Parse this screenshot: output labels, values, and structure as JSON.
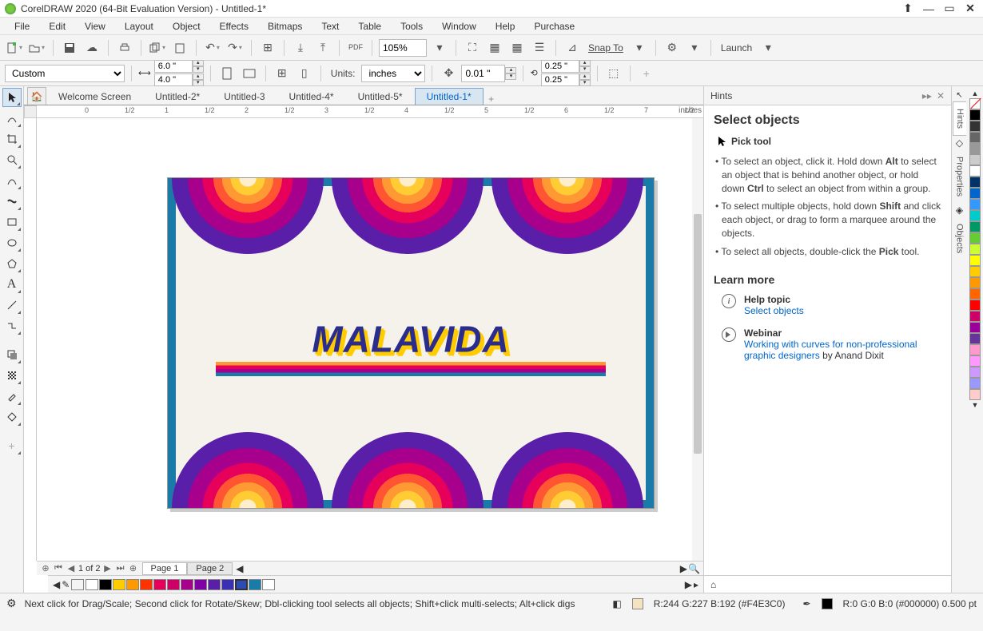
{
  "titlebar": {
    "title": "CorelDRAW 2020 (64-Bit Evaluation Version) - Untitled-1*"
  },
  "menu": [
    "File",
    "Edit",
    "View",
    "Layout",
    "Object",
    "Effects",
    "Bitmaps",
    "Text",
    "Table",
    "Tools",
    "Window",
    "Help",
    "Purchase"
  ],
  "toolbar": {
    "zoom": "105%",
    "snapto": "Snap To",
    "launch": "Launch"
  },
  "propbar": {
    "preset": "Custom",
    "width": "6.0 \"",
    "height": "4.0 \"",
    "units_label": "Units:",
    "units": "inches",
    "nudge": "0.01 \"",
    "dupx": "0.25 \"",
    "dupy": "0.25 \""
  },
  "tabs": {
    "items": [
      "Welcome Screen",
      "Untitled-2*",
      "Untitled-3",
      "Untitled-4*",
      "Untitled-5*",
      "Untitled-1*"
    ],
    "active": 5
  },
  "ruler": {
    "units": "inches"
  },
  "pages": {
    "counter": "1 of 2",
    "tabs": [
      "Page 1",
      "Page 2"
    ],
    "active": 0
  },
  "design": {
    "text": "MALAVIDA"
  },
  "hints": {
    "panel": "Hints",
    "heading": "Select objects",
    "pick_tool": "Pick tool",
    "bullets": [
      {
        "pre": "To select an object, click it. Hold down ",
        "b1": "Alt",
        "mid": " to select an object that is behind another object, or hold down ",
        "b2": "Ctrl",
        "post": " to select an object from within a group."
      },
      {
        "pre": "To select multiple objects, hold down ",
        "b1": "Shift",
        "mid": " and click each object, or drag to form a marquee around the objects.",
        "b2": "",
        "post": ""
      },
      {
        "pre": "To select all objects, double-click the ",
        "b1": "Pick",
        "mid": " tool.",
        "b2": "",
        "post": ""
      }
    ],
    "learn_more": "Learn more",
    "help_topic_label": "Help topic",
    "help_topic_link": "Select objects",
    "webinar_label": "Webinar",
    "webinar_link": "Working with curves for non-professional graphic designers",
    "webinar_by": " by Anand Dixit"
  },
  "docker_tabs": [
    "Hints",
    "Properties",
    "Objects"
  ],
  "palette": [
    "#ffffff",
    "#000000",
    "#ffcc00",
    "#ff9900",
    "#ff3300",
    "#e6005c",
    "#cc0066",
    "#a6008c",
    "#8000a6",
    "#5a1fa8",
    "#3b2fb3",
    "#2b4db3",
    "#1a7aa8",
    "#ffffff"
  ],
  "colorstrip": [
    "none",
    "#000000",
    "#333333",
    "#666666",
    "#999999",
    "#cccccc",
    "#ffffff",
    "#003366",
    "#0066cc",
    "#3399ff",
    "#00cccc",
    "#009966",
    "#66cc33",
    "#ccff33",
    "#ffff00",
    "#ffcc00",
    "#ff9900",
    "#ff6600",
    "#ff0000",
    "#cc0066",
    "#990099",
    "#663399",
    "#ff99cc",
    "#ff99ff",
    "#cc99ff",
    "#9999ff",
    "#ffcccc"
  ],
  "status": {
    "hint": "Next click for Drag/Scale; Second click for Rotate/Skew; Dbl-clicking tool selects all objects; Shift+click multi-selects; Alt+click digs",
    "fill_swatch": "#f4e3c0",
    "fill": "R:244 G:227 B:192 (#F4E3C0)",
    "outline_swatch": "#000000",
    "outline": "R:0 G:0 B:0 (#000000)  0.500 pt"
  }
}
